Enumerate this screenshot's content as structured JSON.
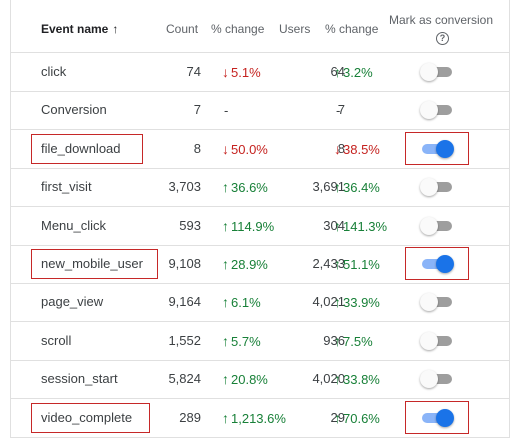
{
  "header": {
    "event_name": "Event name",
    "sort_arrow": "↑",
    "count": "Count",
    "pct_change_1": "% change",
    "users": "Users",
    "pct_change_2": "% change",
    "mark_as_conversion": "Mark as conversion",
    "help": "?"
  },
  "rows": [
    {
      "name": "click",
      "count": "74",
      "count_dir": "down",
      "count_arrow": "↓",
      "count_change": "5.1%",
      "users": "64",
      "users_dir": "up",
      "users_arrow": "↑",
      "users_change": "3.2%",
      "conversion": false
    },
    {
      "name": "Conversion",
      "count": "7",
      "count_dir": "dash",
      "count_arrow": "",
      "count_change": "-",
      "users": "7",
      "users_dir": "dash",
      "users_arrow": "",
      "users_change": "-",
      "conversion": false
    },
    {
      "name": "file_download",
      "count": "8",
      "count_dir": "down",
      "count_arrow": "↓",
      "count_change": "50.0%",
      "users": "8",
      "users_dir": "down",
      "users_arrow": "↓",
      "users_change": "38.5%",
      "conversion": true
    },
    {
      "name": "first_visit",
      "count": "3,703",
      "count_dir": "up",
      "count_arrow": "↑",
      "count_change": "36.6%",
      "users": "3,691",
      "users_dir": "up",
      "users_arrow": "↑",
      "users_change": "36.4%",
      "conversion": false
    },
    {
      "name": "Menu_click",
      "count": "593",
      "count_dir": "up",
      "count_arrow": "↑",
      "count_change": "114.9%",
      "users": "304",
      "users_dir": "up",
      "users_arrow": "↑",
      "users_change": "141.3%",
      "conversion": false
    },
    {
      "name": "new_mobile_user",
      "count": "9,108",
      "count_dir": "up",
      "count_arrow": "↑",
      "count_change": "28.9%",
      "users": "2,433",
      "users_dir": "up",
      "users_arrow": "↑",
      "users_change": "51.1%",
      "conversion": true
    },
    {
      "name": "page_view",
      "count": "9,164",
      "count_dir": "up",
      "count_arrow": "↑",
      "count_change": "6.1%",
      "users": "4,021",
      "users_dir": "up",
      "users_arrow": "↑",
      "users_change": "33.9%",
      "conversion": false
    },
    {
      "name": "scroll",
      "count": "1,552",
      "count_dir": "up",
      "count_arrow": "↑",
      "count_change": "5.7%",
      "users": "936",
      "users_dir": "up",
      "users_arrow": "↑",
      "users_change": "7.5%",
      "conversion": false
    },
    {
      "name": "session_start",
      "count": "5,824",
      "count_dir": "up",
      "count_arrow": "↑",
      "count_change": "20.8%",
      "users": "4,020",
      "users_dir": "up",
      "users_arrow": "↑",
      "users_change": "33.8%",
      "conversion": false
    },
    {
      "name": "video_complete",
      "count": "289",
      "count_dir": "up",
      "count_arrow": "↑",
      "count_change": "1,213.6%",
      "users": "29",
      "users_dir": "up",
      "users_arrow": "↑",
      "users_change": "70.6%",
      "conversion": true
    }
  ],
  "colors": {
    "up": "#188038",
    "down": "#c5221f",
    "toggle_on": "#1a73e8",
    "highlight": "#c62828"
  }
}
